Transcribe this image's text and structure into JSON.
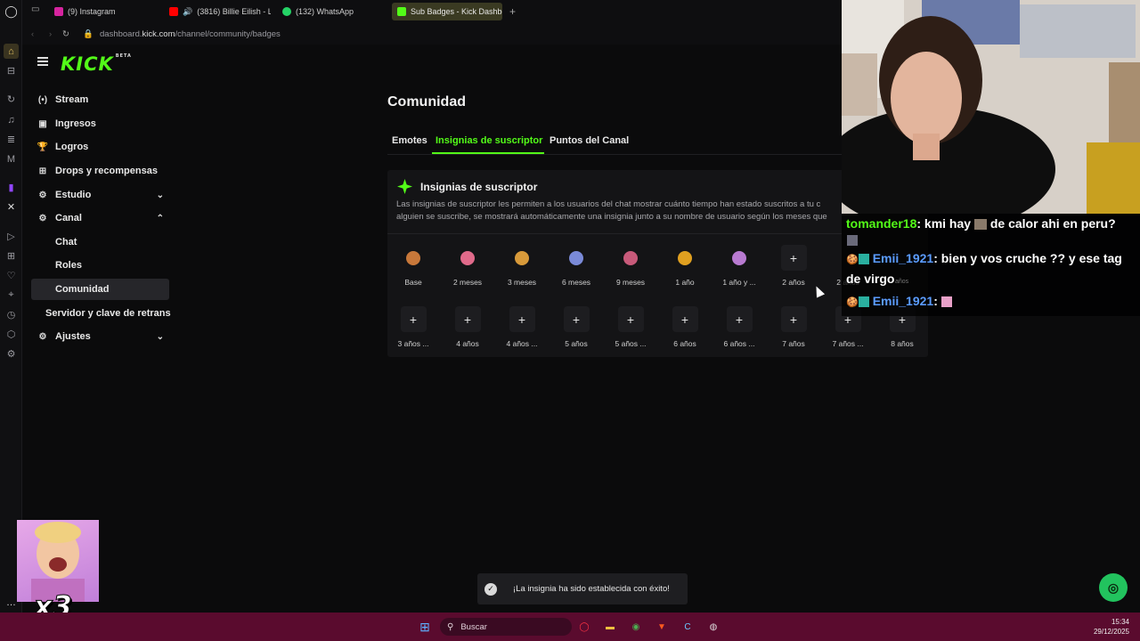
{
  "browser": {
    "tabs": [
      {
        "label": "(9) Instagram",
        "color": "#d6249f"
      },
      {
        "label": "(3816) Billie Eilish - LU",
        "color": "#ff0000"
      },
      {
        "label": "(132) WhatsApp",
        "color": "#25d366"
      },
      {
        "label": "Sub Badges - Kick Dashbo",
        "color": "#53fc18"
      }
    ],
    "address_domain": "dashboard.",
    "address_host": "kick.com",
    "address_path": "/channel/community/badges",
    "sidebar_icons": [
      "home-icon",
      "gamepad-icon",
      "refresh-icon",
      "music-icon",
      "twitch-icon",
      "x-icon",
      "play-icon",
      "grid-icon",
      "heart-icon",
      "history-icon",
      "settings-icon"
    ]
  },
  "kick": {
    "logo": "KICK",
    "logo_beta": "BETA",
    "nav": [
      {
        "label": "Stream",
        "icon": "(•)"
      },
      {
        "label": "Ingresos",
        "icon": "▣"
      },
      {
        "label": "Logros",
        "icon": "🏆"
      },
      {
        "label": "Drops y recompensas",
        "icon": "⊞"
      },
      {
        "label": "Estudio",
        "icon": "⚙",
        "chevron": "⌄"
      },
      {
        "label": "Canal",
        "icon": "⚙",
        "chevron": "⌃"
      }
    ],
    "canal_sub": [
      "Chat",
      "Roles",
      "Comunidad"
    ],
    "more_nav": [
      {
        "label": "Servidor y clave de retrans"
      },
      {
        "label": "Ajustes",
        "icon": "⚙",
        "chevron": "⌄"
      }
    ],
    "page_title": "Comunidad",
    "tabs": [
      "Emotes",
      "Insignias de suscriptor",
      "Puntos del Canal"
    ],
    "card": {
      "title": "Insignias de suscriptor",
      "desc_line1": "Las insignias de suscriptor les permiten a los usuarios del chat mostrar cuánto tiempo han estado suscritos a tu c",
      "desc_line2": "alguien se suscribe, se mostrará automáticamente una insignia junto a su nombre de usuario según los meses que"
    },
    "badges_row1": [
      {
        "label": "Base",
        "color": "#c8783a"
      },
      {
        "label": "2 meses",
        "color": "#e06a8a"
      },
      {
        "label": "3 meses",
        "color": "#d89a3a"
      },
      {
        "label": "6 meses",
        "color": "#7a8ad8"
      },
      {
        "label": "9 meses",
        "color": "#c85a7a"
      },
      {
        "label": "1 año",
        "color": "#e0a020"
      },
      {
        "label": "1 año y ...",
        "color": "#b87ad0"
      },
      {
        "label": "2 años",
        "add": "+"
      },
      {
        "label": "2 años",
        "add": ""
      }
    ],
    "badges_row2": [
      {
        "label": "3 años ...",
        "add": "+"
      },
      {
        "label": "4 años",
        "add": "+"
      },
      {
        "label": "4 años ...",
        "add": "+"
      },
      {
        "label": "5 años",
        "add": "+"
      },
      {
        "label": "5 años ...",
        "add": "+"
      },
      {
        "label": "6 años",
        "add": "+"
      },
      {
        "label": "6 años ...",
        "add": "+"
      },
      {
        "label": "7 años",
        "add": "+"
      },
      {
        "label": "7 años ...",
        "add": "+"
      },
      {
        "label": "8 años",
        "add": "+"
      }
    ],
    "toast": "¡La insignia ha sido establecida con éxito!"
  },
  "chat": {
    "messages": [
      {
        "user": "tomander18",
        "text": ": kmi hay ",
        "text2": " de calor ahi en peru?"
      },
      {
        "user": "Emii_1921",
        "text": ": bien y vos cruche ?? y ese tag"
      },
      {
        "text": "de virgo"
      },
      {
        "user": "Emii_1921",
        "text": ": "
      }
    ],
    "ghost_text": "años"
  },
  "overlay": {
    "multiplier": "x3"
  },
  "taskbar": {
    "search_label": "Buscar",
    "time": "15:34",
    "date": "29/12/2025"
  }
}
